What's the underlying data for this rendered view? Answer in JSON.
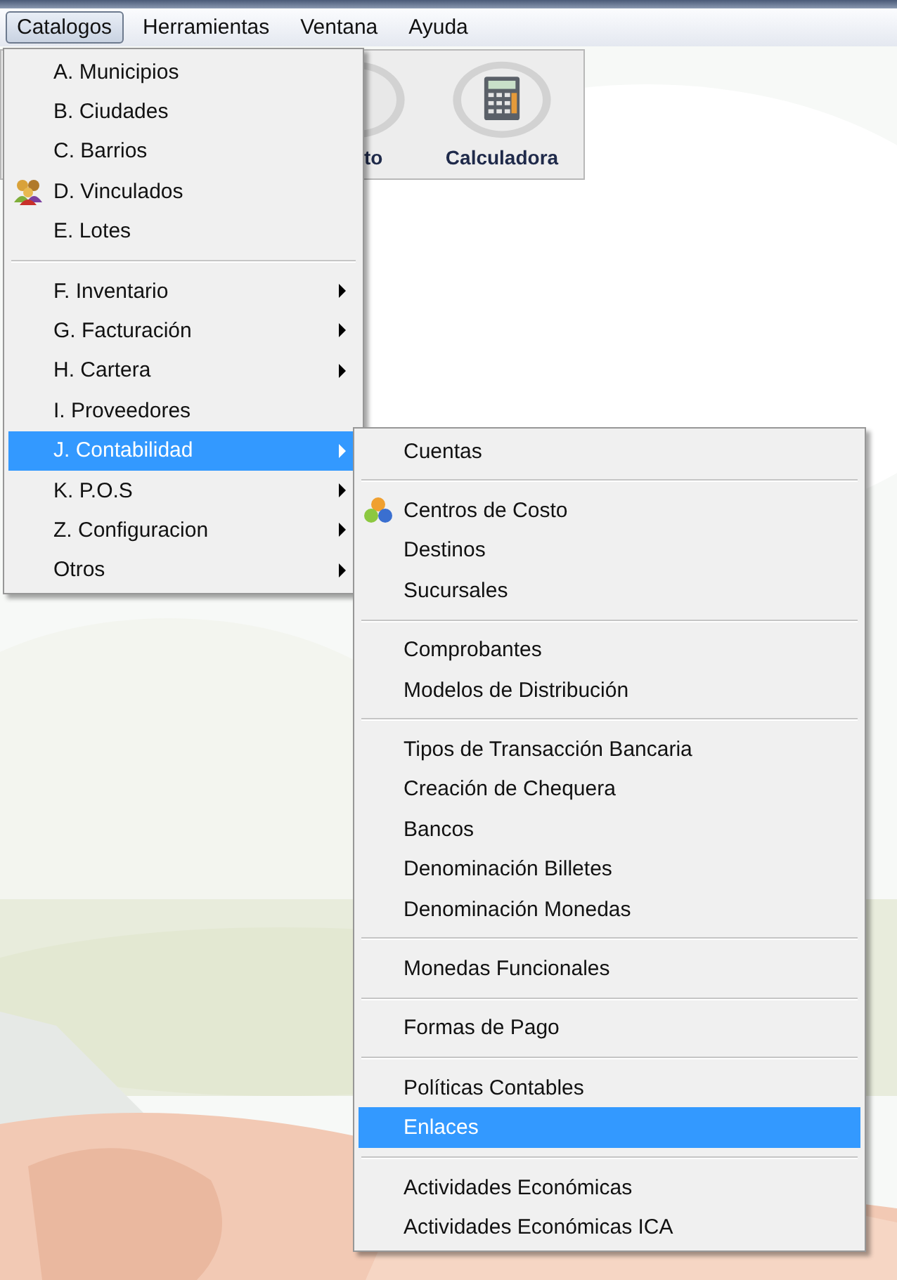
{
  "menu_bar": [
    {
      "label": "Catalogos",
      "selected": true
    },
    {
      "label": "Herramientas",
      "selected": false
    },
    {
      "label": "Ventana",
      "selected": false
    },
    {
      "label": "Ayuda",
      "selected": false
    }
  ],
  "toolbar": [
    {
      "label": "to"
    },
    {
      "label": "Calculadora"
    }
  ],
  "dropdown": {
    "groups": [
      [
        {
          "label": "A. Municipios",
          "kind": "plain",
          "has_submenu": false,
          "selected": false
        },
        {
          "label": "B. Ciudades",
          "kind": "plain",
          "has_submenu": false,
          "selected": false
        },
        {
          "label": "C. Barrios",
          "kind": "plain",
          "has_submenu": false,
          "selected": false
        },
        {
          "label": "D. Vinculados",
          "kind": "people",
          "has_submenu": false,
          "selected": false
        },
        {
          "label": "E. Lotes",
          "kind": "plain",
          "has_submenu": false,
          "selected": false
        }
      ],
      [
        {
          "label": "F.  Inventario",
          "kind": "plain",
          "has_submenu": true,
          "selected": false
        },
        {
          "label": "G. Facturación",
          "kind": "plain",
          "has_submenu": true,
          "selected": false
        },
        {
          "label": "H. Cartera",
          "kind": "plain",
          "has_submenu": true,
          "selected": false
        },
        {
          "label": "I.  Proveedores",
          "kind": "plain",
          "has_submenu": false,
          "selected": false
        },
        {
          "label": "J. Contabilidad",
          "kind": "plain",
          "has_submenu": true,
          "selected": true
        },
        {
          "label": "K. P.O.S",
          "kind": "plain",
          "has_submenu": true,
          "selected": false
        },
        {
          "label": "Z. Configuracion",
          "kind": "plain",
          "has_submenu": true,
          "selected": false
        },
        {
          "label": "Otros",
          "kind": "plain",
          "has_submenu": true,
          "selected": false
        }
      ]
    ]
  },
  "submenu": {
    "groups": [
      [
        {
          "label": "Cuentas",
          "kind": "plain",
          "selected": false
        }
      ],
      [
        {
          "label": "Centros de Costo",
          "kind": "spheres",
          "selected": false
        },
        {
          "label": "Destinos",
          "kind": "plain",
          "selected": false
        },
        {
          "label": "Sucursales",
          "kind": "plain",
          "selected": false
        }
      ],
      [
        {
          "label": "Comprobantes",
          "kind": "plain",
          "selected": false
        },
        {
          "label": "Modelos de Distribución",
          "kind": "plain",
          "selected": false
        }
      ],
      [
        {
          "label": "Tipos de Transacción Bancaria",
          "kind": "plain",
          "selected": false
        },
        {
          "label": "Creación de Chequera",
          "kind": "plain",
          "selected": false
        },
        {
          "label": "Bancos",
          "kind": "plain",
          "selected": false
        },
        {
          "label": "Denominación Billetes",
          "kind": "plain",
          "selected": false
        },
        {
          "label": "Denominación Monedas",
          "kind": "plain",
          "selected": false
        }
      ],
      [
        {
          "label": "Monedas Funcionales",
          "kind": "plain",
          "selected": false
        }
      ],
      [
        {
          "label": "Formas de Pago",
          "kind": "plain",
          "selected": false
        }
      ],
      [
        {
          "label": "Políticas Contables",
          "kind": "plain",
          "selected": false
        },
        {
          "label": "Enlaces",
          "kind": "plain",
          "selected": true
        }
      ],
      [
        {
          "label": "Actividades Económicas",
          "kind": "plain",
          "selected": false
        },
        {
          "label": "Actividades Económicas ICA",
          "kind": "plain",
          "selected": false
        }
      ]
    ]
  }
}
